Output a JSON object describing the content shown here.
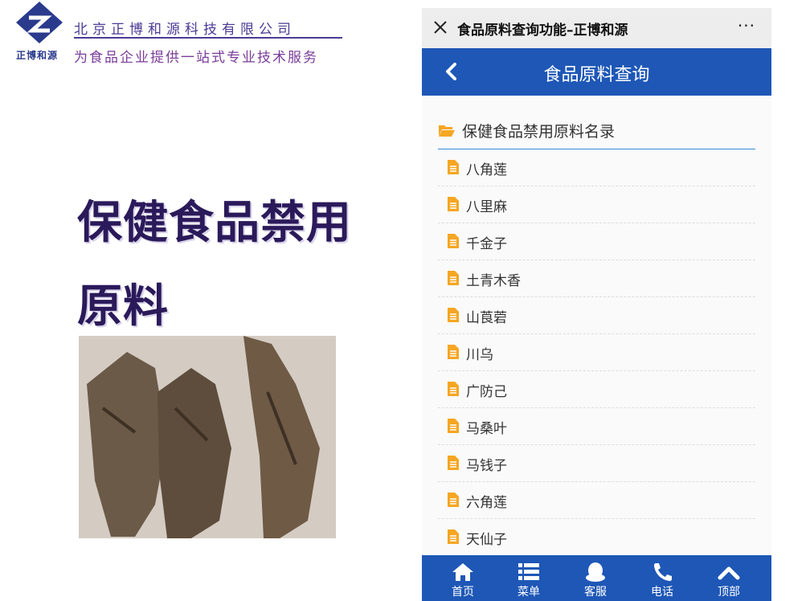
{
  "company": {
    "name": "北京正博和源科技有限公司",
    "brand_small": "正博和源",
    "slogan": "为食品企业提供一站式专业技术服务"
  },
  "promo": {
    "title": "保健食品禁用原料",
    "image_desc": "dried herb roots photo"
  },
  "wechat_bar": {
    "close_icon": "close-icon",
    "title": "食品原料查询功能–正博和源",
    "more": "···"
  },
  "app_header": {
    "back_icon": "chevron-left-icon",
    "title": "食品原料查询"
  },
  "category": {
    "icon": "folder-open-icon",
    "title": "保健食品禁用原料名录"
  },
  "items": [
    {
      "label": "八角莲"
    },
    {
      "label": "八里麻"
    },
    {
      "label": "千金子"
    },
    {
      "label": "土青木香"
    },
    {
      "label": "山莨菪"
    },
    {
      "label": "川乌"
    },
    {
      "label": "广防己"
    },
    {
      "label": "马桑叶"
    },
    {
      "label": "马钱子"
    },
    {
      "label": "六角莲"
    },
    {
      "label": "天仙子"
    }
  ],
  "bottom_nav": [
    {
      "label": "首页",
      "icon": "home-icon"
    },
    {
      "label": "菜单",
      "icon": "menu-icon"
    },
    {
      "label": "客服",
      "icon": "qq-icon"
    },
    {
      "label": "电话",
      "icon": "phone-icon"
    },
    {
      "label": "顶部",
      "icon": "chevron-up-icon"
    }
  ],
  "colors": {
    "header_blue": "#1e57b6",
    "accent_orange": "#f5a623",
    "title_purple": "#2b1a5a"
  }
}
